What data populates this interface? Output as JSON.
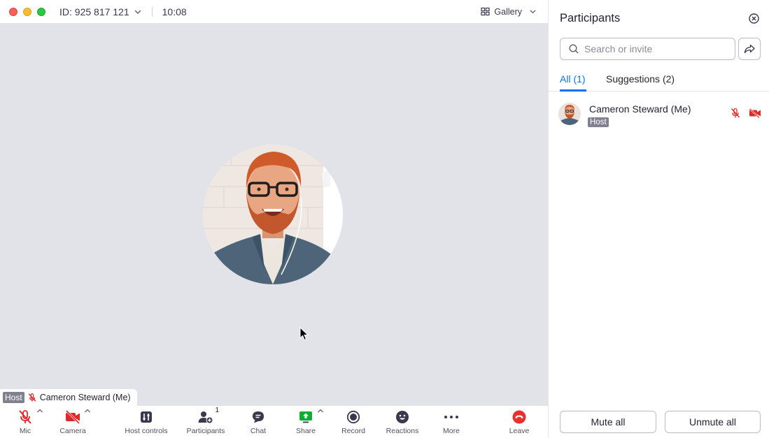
{
  "titlebar": {
    "meeting_id": "ID: 925 817 121",
    "time": "10:08",
    "view_label": "Gallery"
  },
  "video": {
    "name_tag_role": "Host",
    "name_tag_name": "Cameron Steward (Me)"
  },
  "toolbar": {
    "mic": "Mic",
    "camera": "Camera",
    "host_controls": "Host controls",
    "participants": "Participants",
    "participants_count": "1",
    "chat": "Chat",
    "share": "Share",
    "record": "Record",
    "reactions": "Reactions",
    "more": "More",
    "leave": "Leave"
  },
  "panel": {
    "title": "Participants",
    "search_placeholder": "Search or invite",
    "tabs": [
      {
        "label": "All (1)",
        "active": true
      },
      {
        "label": "Suggestions (2)",
        "active": false
      }
    ],
    "participants": [
      {
        "name": "Cameron Steward (Me)",
        "role": "Host",
        "mic_muted": true,
        "camera_off": true
      }
    ],
    "mute_all": "Mute all",
    "unmute_all": "Unmute all"
  },
  "colors": {
    "accent": "#0e72ed",
    "muted_red": "#e02828",
    "share_green": "#0fae33",
    "leave_red": "#e8312f",
    "stage_bg": "#e2e3e8"
  }
}
